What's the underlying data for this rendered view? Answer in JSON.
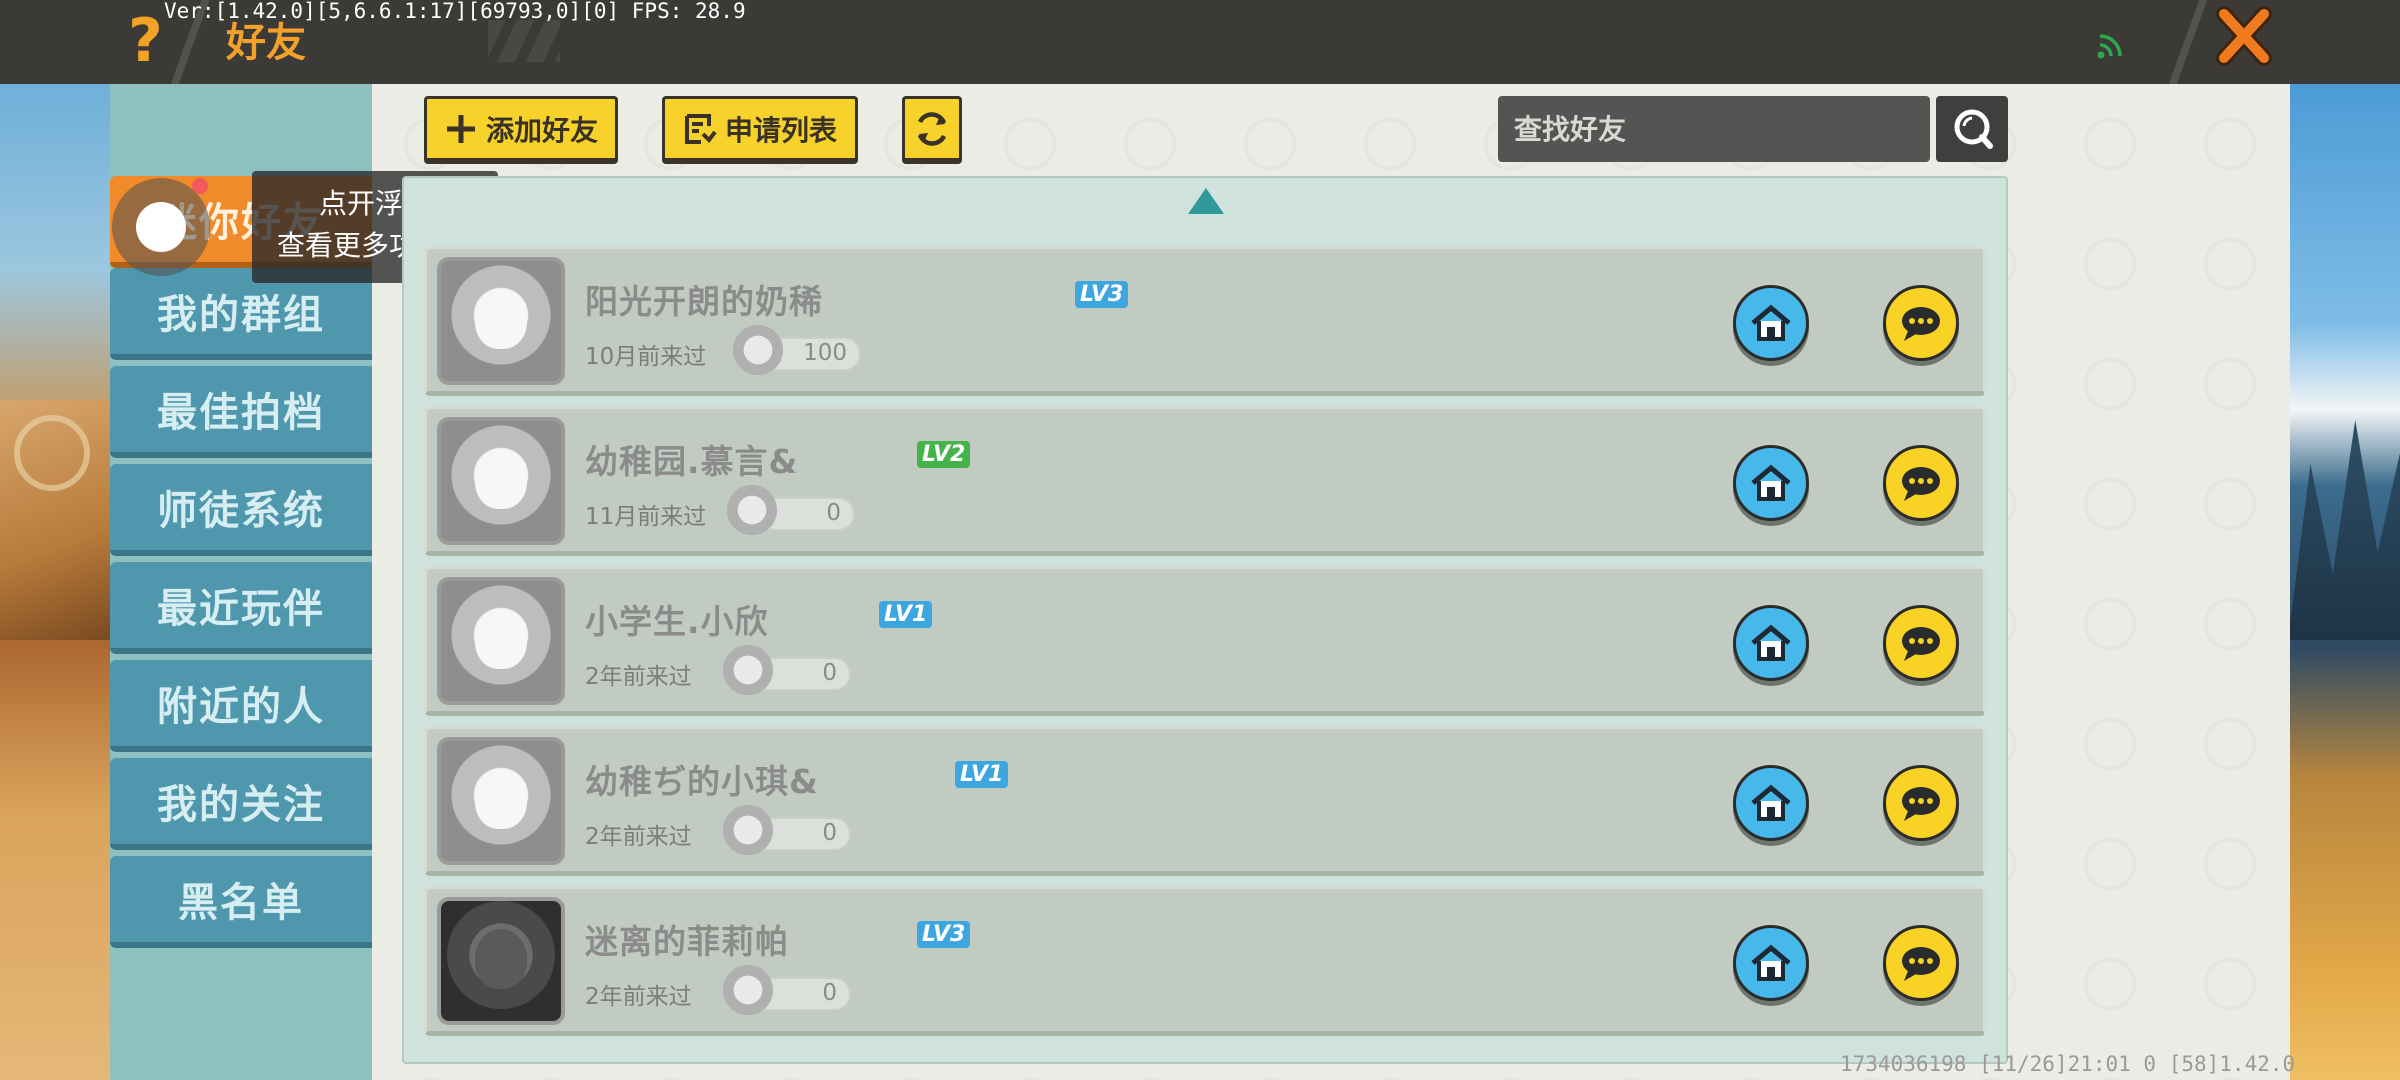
{
  "debug_overlay": "Ver:[1.42.0][5,6.6.1:17][69793,0][0] FPS: 28.9",
  "header": {
    "help_icon": "?",
    "title": "好友",
    "close_icon": "close-icon",
    "colors": {
      "bar": "#3c3a37",
      "accent": "#f2a12c",
      "close": "#f07a1e",
      "signal": "#2aa84a"
    }
  },
  "sidebar": {
    "tabs": [
      {
        "label": "迷你好友",
        "active": true
      },
      {
        "label": "我的群组",
        "active": false
      },
      {
        "label": "最佳拍档",
        "active": false
      },
      {
        "label": "师徒系统",
        "active": false
      },
      {
        "label": "最近玩伴",
        "active": false
      },
      {
        "label": "附近的人",
        "active": false
      },
      {
        "label": "我的关注",
        "active": false
      },
      {
        "label": "黑名单",
        "active": false
      }
    ]
  },
  "tooltip": {
    "line1": "点开浮球",
    "line2": "查看更多功能哦"
  },
  "toolbar": {
    "add_friend_label": "添加好友",
    "request_list_label": "申请列表",
    "refresh_icon": "refresh-icon",
    "search_placeholder": "查找好友",
    "search_icon": "search-icon"
  },
  "friends": [
    {
      "name": "阳光开朗的奶稀",
      "level": "LV3",
      "level_color": "blue",
      "last_seen": "10月前来过",
      "coins": "100",
      "avatar": "astronaut-girl"
    },
    {
      "name": "幼稚园.慕言&",
      "level": "LV2",
      "level_color": "green",
      "last_seen": "11月前来过",
      "coins": "0",
      "avatar": "cat-ear-girl"
    },
    {
      "name": "小学生.小欣",
      "level": "LV1",
      "level_color": "blue",
      "last_seen": "2年前来过",
      "coins": "0",
      "avatar": "blonde-girl"
    },
    {
      "name": "幼稚ぢ的小琪&",
      "level": "LV1",
      "level_color": "blue",
      "last_seen": "2年前来过",
      "coins": "0",
      "avatar": "cat-ear-girl"
    },
    {
      "name": "迷离的菲莉帕",
      "level": "LV3",
      "level_color": "blue",
      "last_seen": "2年前来过",
      "coins": "0",
      "avatar": "dark-character"
    }
  ],
  "footer": "1734036198   [11/26]21:01 0  [58]1.42.0"
}
